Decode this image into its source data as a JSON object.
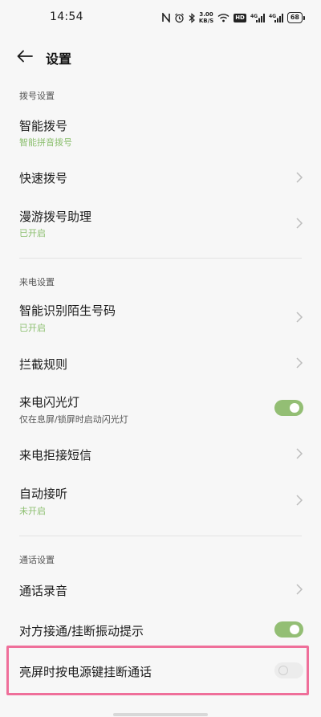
{
  "status_bar": {
    "time": "14:54",
    "net_speed_value": "3.00",
    "net_speed_unit": "KB/S",
    "hd_label": "HD",
    "signal1_label": "4G",
    "signal2_label": "4G",
    "battery": "68"
  },
  "header": {
    "title": "设置"
  },
  "sections": {
    "dial": {
      "title": "拨号设置",
      "items": [
        {
          "title": "智能拨号",
          "subtitle": "智能拼音拨号"
        },
        {
          "title": "快速拨号"
        },
        {
          "title": "漫游拨号助理",
          "subtitle": "已开启"
        }
      ]
    },
    "incoming": {
      "title": "来电设置",
      "items": [
        {
          "title": "智能识别陌生号码",
          "subtitle": "已开启"
        },
        {
          "title": "拦截规则"
        },
        {
          "title": "来电闪光灯",
          "subtitle": "仅在息屏/锁屏时启动闪光灯",
          "toggle": true
        },
        {
          "title": "来电拒接短信"
        },
        {
          "title": "自动接听",
          "subtitle": "未开启"
        }
      ]
    },
    "call": {
      "title": "通话设置",
      "items": [
        {
          "title": "通话录音"
        },
        {
          "title": "对方接通/挂断振动提示",
          "toggle": true
        },
        {
          "title": "亮屏时按电源键挂断通话",
          "toggle": false
        }
      ]
    }
  },
  "colors": {
    "accent_green": "#93be74",
    "subtitle_green": "#8cbf6f",
    "highlight_pink": "#ef6f9a",
    "background": "#f7f7f7"
  }
}
